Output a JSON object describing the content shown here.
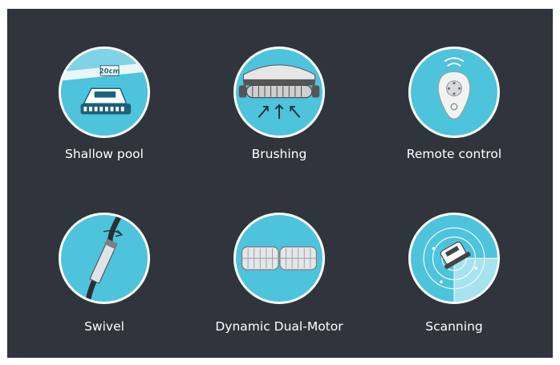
{
  "features": [
    {
      "label": "Shallow pool",
      "icon": "shallow-pool-icon",
      "pool_depth_text": "20cm"
    },
    {
      "label": "Brushing",
      "icon": "brushing-icon"
    },
    {
      "label": "Remote control",
      "icon": "remote-control-icon"
    },
    {
      "label": "Swivel",
      "icon": "swivel-icon"
    },
    {
      "label": "Dynamic Dual-Motor",
      "icon": "dual-motor-icon"
    },
    {
      "label": "Scanning",
      "icon": "scanning-icon"
    }
  ],
  "colors": {
    "background": "#30353d",
    "circle_fill": "#4ec3dc",
    "circle_border": "#ffffff",
    "text": "#ffffff"
  }
}
